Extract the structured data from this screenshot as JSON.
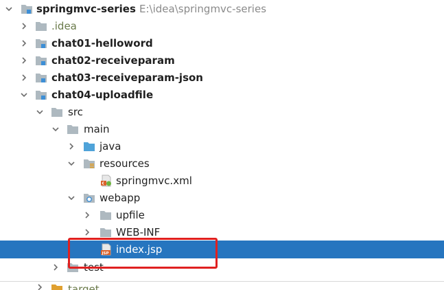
{
  "project": {
    "name": "springmvc-series",
    "path": "E:\\idea\\springmvc-series"
  },
  "tree": {
    "idea": ".idea",
    "chat01": "chat01-helloword",
    "chat02": "chat02-receiveparam",
    "chat03": "chat03-receiveparam-json",
    "chat04": "chat04-uploadfile",
    "src": "src",
    "main": "main",
    "java": "java",
    "resources": "resources",
    "springmvc_xml": "springmvc.xml",
    "webapp": "webapp",
    "upfile": "upfile",
    "web_inf": "WEB-INF",
    "index_jsp": "index.jsp",
    "test": "test",
    "target": "target"
  },
  "icons": {
    "folder": "folder-icon",
    "module": "module-folder-icon",
    "source_root": "source-root-icon",
    "resources_root": "resources-root-icon",
    "web_root": "web-root-icon",
    "xml_file": "xml-file-icon",
    "jsp_file": "jsp-file-icon"
  },
  "colors": {
    "selection": "#2675bf",
    "highlight_box": "#e02020",
    "folder": "#aeb9c0",
    "module_mark": "#3d8fd6",
    "source_folder": "#4fa3d9"
  }
}
